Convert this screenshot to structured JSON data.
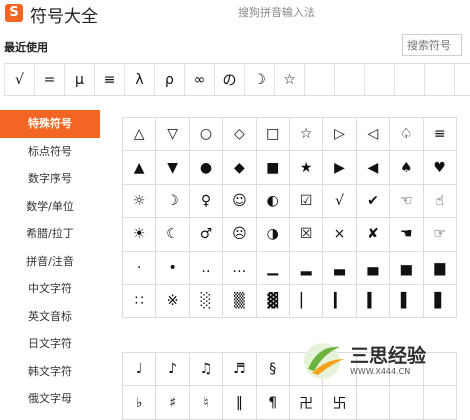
{
  "header": {
    "logo_char": "S",
    "title": "符号大全",
    "subtitle": "搜狗拼音输入法"
  },
  "recent": {
    "label": "最近使用",
    "search_placeholder": "搜索符号",
    "symbols": [
      "√",
      "=",
      "μ",
      "≡",
      "λ",
      "ρ",
      "∞",
      "の",
      "☽",
      "☆",
      "",
      "",
      "",
      "",
      "",
      ""
    ]
  },
  "sidebar": {
    "items": [
      "特殊符号",
      "标点符号",
      "数字序号",
      "数学/单位",
      "希腊/拉丁",
      "拼音/注音",
      "中文字符",
      "英文音标",
      "日文字符",
      "韩文字符",
      "俄文字母"
    ]
  },
  "grid": {
    "symbols": [
      "△",
      "▽",
      "○",
      "◇",
      "□",
      "☆",
      "▷",
      "◁",
      "♤",
      "≡",
      "▲",
      "▼",
      "●",
      "◆",
      "■",
      "★",
      "▶",
      "◀",
      "♠",
      "♥",
      "☼",
      "☽",
      "♀",
      "☺",
      "◐",
      "☑",
      "√",
      "✔",
      "☜",
      "☝",
      "☀",
      "☾",
      "♂",
      "☹",
      "◑",
      "☒",
      "×",
      "✘",
      "☚",
      "☞",
      "·",
      "•",
      "‥",
      "…",
      "▁",
      "▂",
      "▃",
      "▄",
      "▅",
      "▆",
      "∷",
      "※",
      "░",
      "▒",
      "▓",
      "▏",
      "▎",
      "▍",
      "▌",
      "▋"
    ]
  },
  "grid2": {
    "symbols": [
      "♩",
      "♪",
      "♫",
      "♬",
      "§",
      "",
      "",
      "",
      "",
      "",
      "♭",
      "♯",
      "♮",
      "‖",
      "¶",
      "卍",
      "卐",
      "",
      "",
      ""
    ]
  },
  "watermark": {
    "text": "三思经验",
    "url": "WWW.X444.CN"
  },
  "colors": {
    "accent": "#f26522",
    "grid_border": "#dcdcdc"
  }
}
